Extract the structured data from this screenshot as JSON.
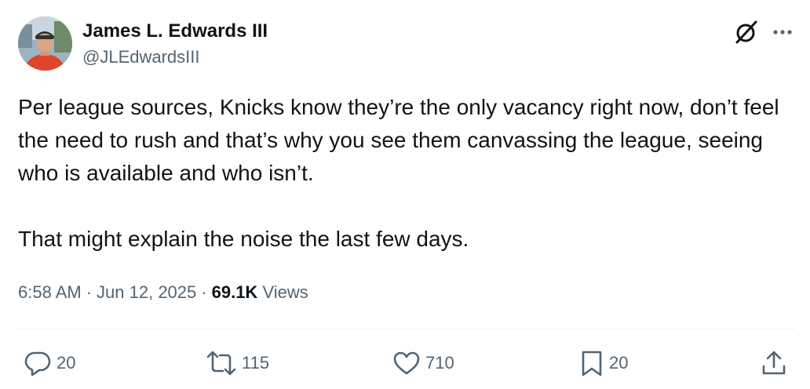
{
  "author": {
    "display_name": "James L. Edwards III",
    "handle": "@JLEdwardsIII"
  },
  "tweet": {
    "text": "Per league sources, Knicks know they’re the only vacancy right now, don’t feel the need to rush and that’s why you see them canvassing the league, seeing who is available and who isn’t.\n\nThat might explain the noise the last few days.",
    "time": "6:58 AM",
    "date": "Jun 12, 2025",
    "separator": "·",
    "views_count": "69.1K",
    "views_label": "Views"
  },
  "actions": {
    "replies": "20",
    "reposts": "115",
    "likes": "710",
    "bookmarks": "20"
  },
  "icons": {
    "top_right": [
      "grok-icon",
      "more-icon"
    ],
    "actions": [
      "reply-icon",
      "repost-icon",
      "like-icon",
      "bookmark-icon",
      "share-icon"
    ]
  },
  "colors": {
    "text_primary": "#0f1419",
    "text_secondary": "#536471",
    "divider": "#eff3f4"
  }
}
